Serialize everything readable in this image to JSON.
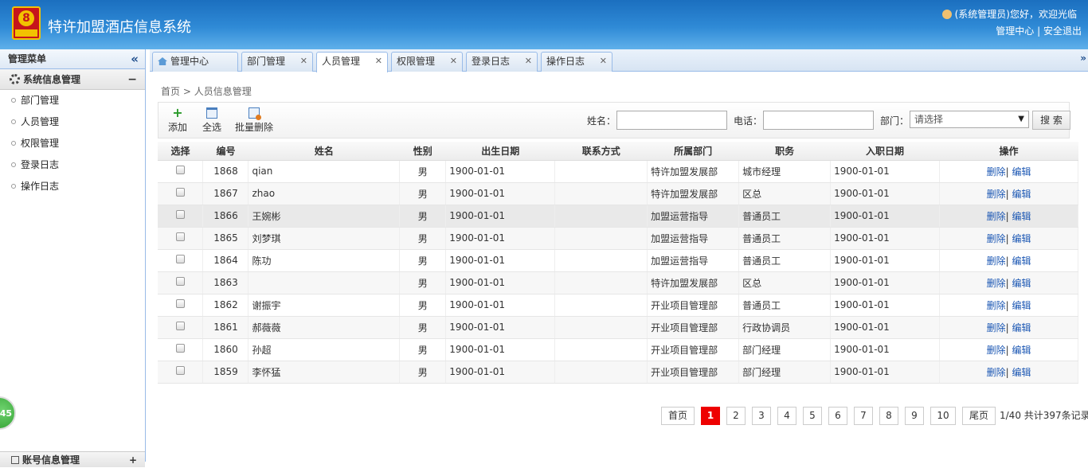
{
  "header": {
    "title": "特许加盟酒店信息系统",
    "logo_number": "8",
    "greeting": "(系统管理员)您好，欢迎光临",
    "admin_center": "管理中心",
    "divider": "|",
    "logout": "安全退出"
  },
  "sidebar": {
    "title": "管理菜单",
    "section": "系统信息管理",
    "section_toggle": "−",
    "items": [
      "部门管理",
      "人员管理",
      "权限管理",
      "登录日志",
      "操作日志"
    ],
    "bottom_section": "账号信息管理",
    "bottom_toggle": "+",
    "float_badge": "45"
  },
  "tabs": [
    {
      "label": "管理中心",
      "closable": false
    },
    {
      "label": "部门管理",
      "closable": true
    },
    {
      "label": "人员管理",
      "closable": true,
      "active": true
    },
    {
      "label": "权限管理",
      "closable": true
    },
    {
      "label": "登录日志",
      "closable": true
    },
    {
      "label": "操作日志",
      "closable": true
    }
  ],
  "breadcrumb": {
    "home": "首页",
    "sep": ">",
    "current": "人员信息管理"
  },
  "toolbar": {
    "add": "添加",
    "select_all": "全选",
    "batch_delete": "批量删除"
  },
  "filters": {
    "name_label": "姓名：",
    "phone_label": "电话：",
    "dept_label": "部门：",
    "dept_placeholder": "请选择",
    "search": "搜 索"
  },
  "table": {
    "columns": [
      "选择",
      "编号",
      "姓名",
      "性别",
      "出生日期",
      "联系方式",
      "所属部门",
      "职务",
      "入职日期",
      "操作"
    ],
    "delete_label": "删除",
    "edit_label": "编辑",
    "op_sep": "|",
    "rows": [
      {
        "id": "1868",
        "name": "qian",
        "gender": "男",
        "birth": "1900-01-01",
        "contact": "",
        "dept": "特许加盟发展部",
        "title": "城市经理",
        "join": "1900-01-01"
      },
      {
        "id": "1867",
        "name": "zhao",
        "gender": "男",
        "birth": "1900-01-01",
        "contact": "",
        "dept": "特许加盟发展部",
        "title": "区总",
        "join": "1900-01-01"
      },
      {
        "id": "1866",
        "name": "王婉彬",
        "gender": "男",
        "birth": "1900-01-01",
        "contact": "",
        "dept": "加盟运营指导",
        "title": "普通员工",
        "join": "1900-01-01"
      },
      {
        "id": "1865",
        "name": "刘梦琪",
        "gender": "男",
        "birth": "1900-01-01",
        "contact": "",
        "dept": "加盟运营指导",
        "title": "普通员工",
        "join": "1900-01-01"
      },
      {
        "id": "1864",
        "name": "陈功",
        "gender": "男",
        "birth": "1900-01-01",
        "contact": "",
        "dept": "加盟运营指导",
        "title": "普通员工",
        "join": "1900-01-01"
      },
      {
        "id": "1863",
        "name": "",
        "gender": "男",
        "birth": "1900-01-01",
        "contact": "",
        "dept": "特许加盟发展部",
        "title": "区总",
        "join": "1900-01-01"
      },
      {
        "id": "1862",
        "name": "谢振宇",
        "gender": "男",
        "birth": "1900-01-01",
        "contact": "",
        "dept": "开业项目管理部",
        "title": "普通员工",
        "join": "1900-01-01"
      },
      {
        "id": "1861",
        "name": "郝薇薇",
        "gender": "男",
        "birth": "1900-01-01",
        "contact": "",
        "dept": "开业项目管理部",
        "title": "行政协调员",
        "join": "1900-01-01"
      },
      {
        "id": "1860",
        "name": "孙超",
        "gender": "男",
        "birth": "1900-01-01",
        "contact": "",
        "dept": "开业项目管理部",
        "title": "部门经理",
        "join": "1900-01-01"
      },
      {
        "id": "1859",
        "name": "李怀猛",
        "gender": "男",
        "birth": "1900-01-01",
        "contact": "",
        "dept": "开业项目管理部",
        "title": "部门经理",
        "join": "1900-01-01"
      }
    ]
  },
  "pager": {
    "first": "首页",
    "pages": [
      "1",
      "2",
      "3",
      "4",
      "5",
      "6",
      "7",
      "8",
      "9",
      "10"
    ],
    "current": "1",
    "last": "尾页",
    "info": "1/40 共计397条记录"
  }
}
